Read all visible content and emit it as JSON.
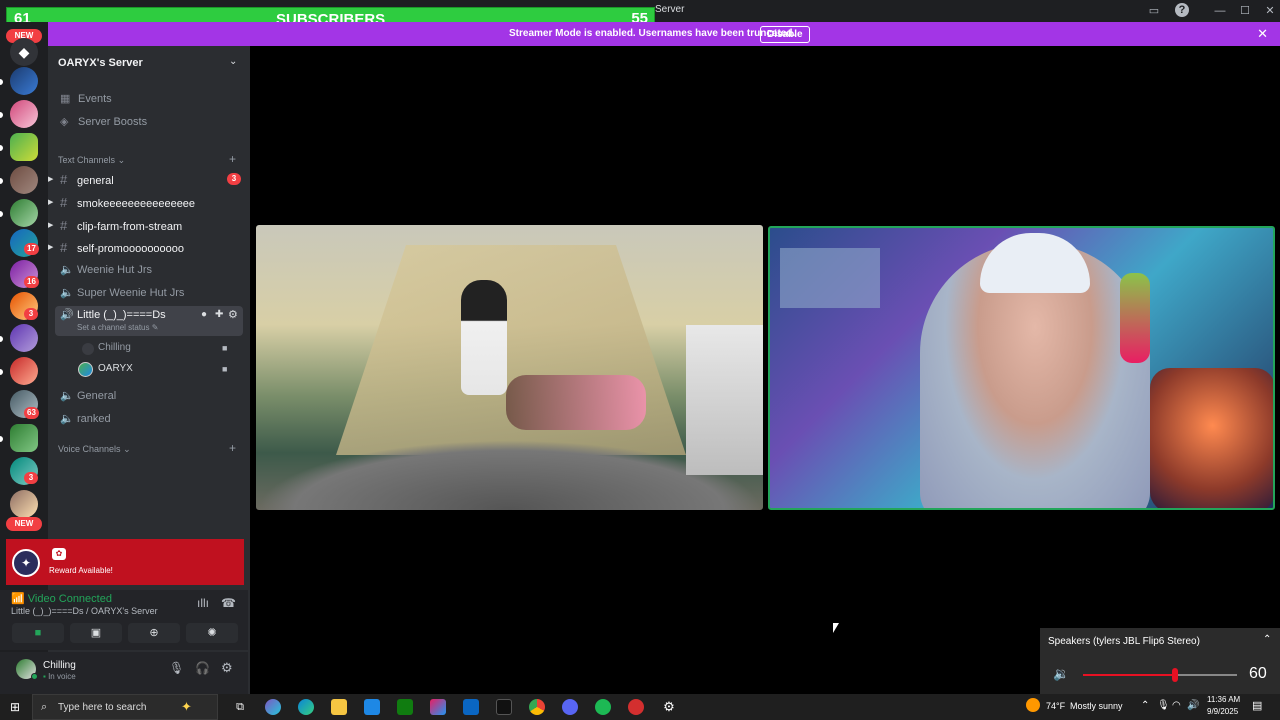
{
  "subscriber_banner": {
    "left_count": "61",
    "label": "SUBSCRIBERS",
    "right_count": "55"
  },
  "window": {
    "title": "Server"
  },
  "streamer_bar": {
    "message": "Streamer Mode is enabled. Usernames have been truncated.",
    "disable_label": "Disable"
  },
  "server_rail": {
    "top_badge": "NEW",
    "badges": [
      "17",
      "16",
      "3",
      "63",
      "3"
    ],
    "bottom_badge": "NEW"
  },
  "sidebar": {
    "server_name": "OARYX's Server",
    "nav": [
      {
        "label": "Events",
        "icon": "calendar-icon"
      },
      {
        "label": "Server Boosts",
        "icon": "boost-icon"
      }
    ],
    "text_category": "Text Channels",
    "text_channels": [
      {
        "name": "general",
        "unread": "3"
      },
      {
        "name": "smokeeeeeeeeeeeeeee"
      },
      {
        "name": "clip-farm-from-stream"
      },
      {
        "name": "self-promoooooooooo"
      }
    ],
    "voice_list": [
      {
        "name": "Weenie Hut Jrs"
      },
      {
        "name": "Super Weenie Hut Jrs"
      },
      {
        "name": "Little (_)_)====Ds",
        "status": "Set a channel status"
      }
    ],
    "voice_members": [
      {
        "name": "Chilling"
      },
      {
        "name": "OARYX"
      }
    ],
    "more_voice": [
      {
        "name": "General"
      },
      {
        "name": "ranked"
      }
    ],
    "voice_category": "Voice Channels"
  },
  "reward": {
    "label": "Reward Available!"
  },
  "voice_connection": {
    "status": "Video Connected",
    "location": "Little (_)_)====Ds / OARYX's Server"
  },
  "user_panel": {
    "name": "Chilling",
    "status": "In voice"
  },
  "speaker_popup": {
    "device": "Speakers (tylers JBL Flip6 Stereo)",
    "volume": "60",
    "volume_level": 0.6
  },
  "taskbar": {
    "search_placeholder": "Type here to search",
    "weather_temp": "74°F",
    "weather_desc": "Mostly sunny",
    "time": "11:36 AM",
    "date": "9/9/2025"
  },
  "colors": {
    "accent_green": "#2ecc40",
    "streamer_purple": "#a335e6",
    "reward_red": "#c0111f",
    "voice_green": "#23a55a",
    "slider_red": "#e81123"
  }
}
